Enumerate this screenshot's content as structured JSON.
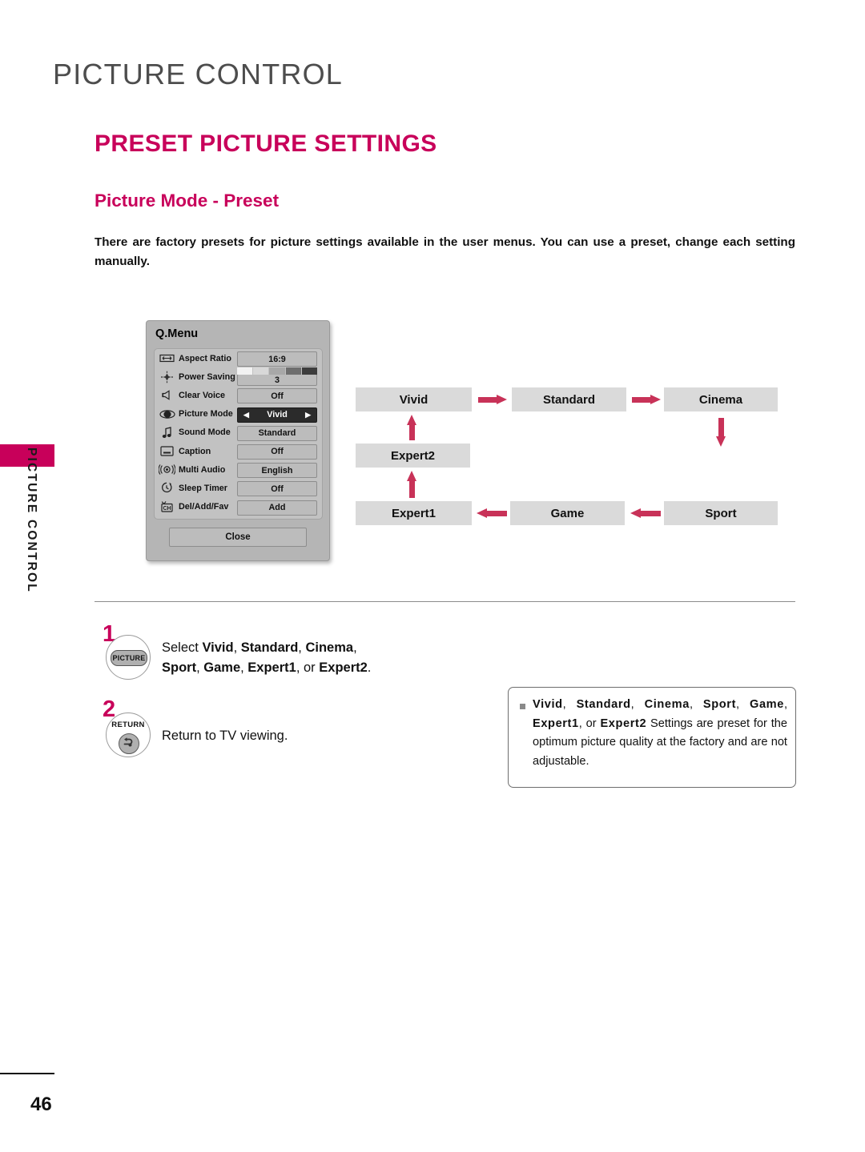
{
  "document": {
    "chapter_title": "PICTURE CONTROL",
    "section_title": "PRESET PICTURE SETTINGS",
    "subsection_title": "Picture Mode - Preset",
    "intro_paragraph": "There are factory presets for picture settings available in the user menus. You can use a preset, change each setting manually.",
    "side_tab_label": "PICTURE CONTROL",
    "page_number": "46",
    "accent_color": "#c8005a",
    "heading_gray": "#4d4d4d"
  },
  "qmenu": {
    "title": "Q.Menu",
    "close_label": "Close",
    "rows": [
      {
        "icon": "aspect-ratio-icon",
        "label": "Aspect Ratio",
        "value": "16:9",
        "selected": false,
        "bar": null
      },
      {
        "icon": "power-saving-icon",
        "label": "Power Saving",
        "value": "3",
        "selected": false,
        "bar": 5
      },
      {
        "icon": "clear-voice-icon",
        "label": "Clear Voice",
        "value": "Off",
        "selected": false,
        "bar": null
      },
      {
        "icon": "picture-mode-icon",
        "label": "Picture Mode",
        "value": "Vivid",
        "selected": true,
        "bar": null
      },
      {
        "icon": "sound-mode-icon",
        "label": "Sound Mode",
        "value": "Standard",
        "selected": false,
        "bar": null
      },
      {
        "icon": "caption-icon",
        "label": "Caption",
        "value": "Off",
        "selected": false,
        "bar": null
      },
      {
        "icon": "multi-audio-icon",
        "label": "Multi Audio",
        "value": "English",
        "selected": false,
        "bar": null
      },
      {
        "icon": "sleep-timer-icon",
        "label": "Sleep Timer",
        "value": "Off",
        "selected": false,
        "bar": null
      },
      {
        "icon": "channel-icon",
        "label": "Del/Add/Fav",
        "value": "Add",
        "selected": false,
        "bar": null
      }
    ],
    "caret_left": "◀",
    "caret_right": "▶"
  },
  "flow_diagram": {
    "arrow_color": "#c83258",
    "box_color": "#dadada",
    "boxes": [
      {
        "id": "vivid",
        "label": "Vivid"
      },
      {
        "id": "standard",
        "label": "Standard"
      },
      {
        "id": "cinema",
        "label": "Cinema"
      },
      {
        "id": "expert2",
        "label": "Expert2"
      },
      {
        "id": "expert1",
        "label": "Expert1"
      },
      {
        "id": "game",
        "label": "Game"
      },
      {
        "id": "sport",
        "label": "Sport"
      }
    ],
    "transitions": [
      {
        "from": "Vivid",
        "to": "Standard",
        "direction": "right"
      },
      {
        "from": "Standard",
        "to": "Cinema",
        "direction": "right"
      },
      {
        "from": "Cinema",
        "to": "Sport",
        "direction": "down"
      },
      {
        "from": "Sport",
        "to": "Game",
        "direction": "left"
      },
      {
        "from": "Game",
        "to": "Expert1",
        "direction": "left"
      },
      {
        "from": "Expert1",
        "to": "Expert2",
        "direction": "up"
      },
      {
        "from": "Expert2",
        "to": "Vivid",
        "direction": "up"
      }
    ]
  },
  "steps": [
    {
      "number": "1",
      "button_label": "PICTURE",
      "button_kind": "picture-key",
      "text_html": "Select <b>Vivid</b>, <b>Standard</b>, <b>Cinema</b>,<br><b>Sport</b>, <b>Game</b>, <b>Expert1</b>, or <b>Expert2</b>."
    },
    {
      "number": "2",
      "button_label": "RETURN",
      "button_kind": "return-key",
      "text_html": "Return to TV viewing."
    }
  ],
  "note": {
    "bullet": "■",
    "text_html": "<b class=\"wide\">Vivid</b>, <b class=\"wide\">Standard</b>, <b class=\"wide\">Cinema</b>, <b class=\"wide\">Sport</b>, <b class=\"wide\">Game</b>, <b class=\"wide\">Expert1</b>, or <b class=\"wide\">Expert2</b> Settings are preset for the optimum picture quality at the factory and are not adjustable."
  }
}
